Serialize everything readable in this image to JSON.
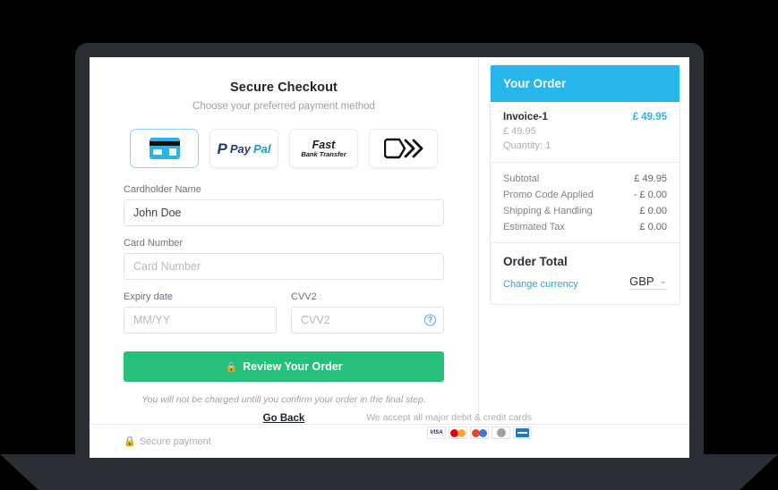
{
  "checkout": {
    "title": "Secure Checkout",
    "subtitle": "Choose your preferred payment method",
    "methods": [
      {
        "id": "card",
        "label": "Credit or debit card",
        "icon": "credit-card-icon",
        "selected": true
      },
      {
        "id": "paypal",
        "label": "PayPal",
        "mark": "P",
        "word1": "Pay",
        "word2": "Pal",
        "selected": false
      },
      {
        "id": "fast-bank-transfer",
        "label": "Fast Bank Transfer",
        "line1": "Fast",
        "line2": "Bank Transfer",
        "selected": false
      },
      {
        "id": "chevron-wallet",
        "label": "Chevron Pay",
        "icon": "chevron-arrows-icon",
        "selected": false
      }
    ],
    "form": {
      "cardholder_label": "Cardholder Name",
      "cardholder_value": "John Doe",
      "cardholder_placeholder": "Cardholder Name",
      "card_number_label": "Card Number",
      "card_number_value": "",
      "card_number_placeholder": "Card Number",
      "expiry_label": "Expiry date",
      "expiry_value": "",
      "expiry_placeholder": "MM/YY",
      "cvv_label": "CVV2",
      "cvv_value": "",
      "cvv_placeholder": "CVV2",
      "cvv_help_icon": "question-circle-icon"
    },
    "cta_label": "Review Your Order",
    "cta_icon": "lock-icon",
    "cta_color": "#27c07a",
    "note": "You will not be charged untill you confirm your order in the final step.",
    "go_back_label": "Go Back"
  },
  "order": {
    "header": "Your Order",
    "header_color": "#26b6ec",
    "items": [
      {
        "name": "Invoice-1",
        "price": "£ 49.95",
        "unit_price": "£ 49.95",
        "quantity": "Quantity: 1"
      }
    ],
    "totals": [
      {
        "label": "Subtotal",
        "amount": "£ 49.95"
      },
      {
        "label": "Promo Code Applied",
        "amount": "- £ 0.00"
      },
      {
        "label": "Shipping & Handling",
        "amount": "£ 0.00"
      },
      {
        "label": "Estimated Tax",
        "amount": "£ 0.00"
      }
    ],
    "total_label": "Order Total",
    "change_currency_label": "Change currency",
    "currency_value": "GBP",
    "currency_chevron": "chevron-down-icon"
  },
  "footer": {
    "secure_label": "Secure payment",
    "secure_icon": "lock-icon",
    "accept_text": "We accept all major debit & credit cards",
    "brands": [
      {
        "id": "visa",
        "label": "VISA"
      },
      {
        "id": "mastercard",
        "label": "Mastercard"
      },
      {
        "id": "maestro",
        "label": "Maestro"
      },
      {
        "id": "diners-club",
        "label": "Diners Club"
      },
      {
        "id": "american-express",
        "label": "American Express"
      }
    ]
  }
}
